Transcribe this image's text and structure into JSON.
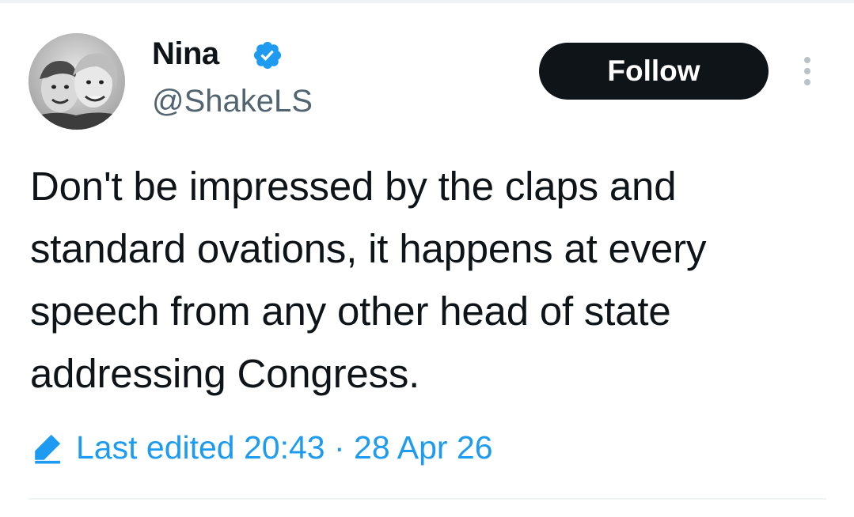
{
  "author": {
    "display_name": "Nina",
    "handle": "@ShakeLS",
    "verified": true,
    "avatar_icon": "profile-photo-avatar"
  },
  "actions": {
    "follow_label": "Follow",
    "more_icon": "more-vertical-icon"
  },
  "tweet": {
    "text": "Don't be impressed by the claps and standard ovations, it happens at every speech from any other head of state addressing Congress."
  },
  "meta": {
    "edited_icon": "pencil-icon",
    "edited_label": "Last edited 20:43 · 28 Apr 26"
  },
  "colors": {
    "text_primary": "#0f1419",
    "text_secondary": "#536471",
    "accent_blue": "#1d9bf0",
    "button_bg": "#0f1419",
    "divider": "#eff3f4"
  }
}
